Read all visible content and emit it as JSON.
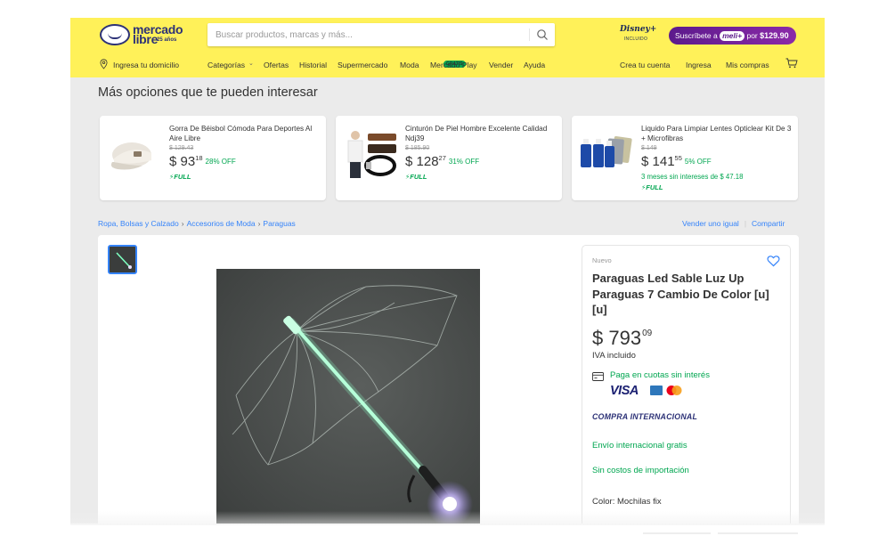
{
  "header": {
    "logo_line1": "mercado",
    "logo_line2": "libre",
    "logo_anos": "25 años",
    "search_placeholder": "Buscar productos, marcas y más...",
    "disney_label": "Disney+",
    "disney_sub": "INCLUIDO",
    "meli_promo": {
      "prefix": "Suscríbete a",
      "brand": "meli+",
      "mid": "por",
      "price": "$129.90"
    },
    "accent": "#fff159"
  },
  "nav": {
    "location": "Ingresa tu domicilio",
    "items": [
      "Categorías",
      "Ofertas",
      "Historial",
      "Supermercado",
      "Moda",
      "Mercado Play",
      "Vender",
      "Ayuda"
    ],
    "gratis_badge": "GRATIS",
    "right": [
      "Crea tu cuenta",
      "Ingresa",
      "Mis compras"
    ]
  },
  "more_options": {
    "title": "Más opciones que te pueden interesar",
    "cards": [
      {
        "title": "Gorra De Béisbol Cómoda Para Deportes Al Aire Libre",
        "old_price": "$ 129.43",
        "price": "$ 93",
        "cents": "18",
        "off": "28% OFF",
        "badge": "FULL",
        "icon": "cap-image"
      },
      {
        "title": "Cinturón De Piel Hombre Excelente Calidad Ndj39",
        "old_price": "$ 185.90",
        "price": "$ 128",
        "cents": "27",
        "off": "31% OFF",
        "badge": "FULL",
        "icon": "belts-image"
      },
      {
        "title": "Liquido Para Limpiar Lentes Opticlear Kit De 3 + Microfibras",
        "old_price": "$ 149",
        "price": "$ 141",
        "cents": "55",
        "off": "5% OFF",
        "installments": "3 meses sin intereses de $ 47.18",
        "badge": "FULL",
        "icon": "spray-bottles-image"
      }
    ]
  },
  "breadcrumb": [
    "Ropa, Bolsas y Calzado",
    "Accesorios de Moda",
    "Paraguas"
  ],
  "actions": [
    "Vender uno igual",
    "Compartir"
  ],
  "product": {
    "condition": "Nuevo",
    "title": "Paraguas Led Sable Luz Up Paraguas 7 Cambio De Color [u] [u]",
    "price": "$ 793",
    "cents": "09",
    "iva": "IVA incluido",
    "installments_link": "Paga en cuotas sin interés",
    "visa": "VISA",
    "international": "COMPRA INTERNACIONAL",
    "shipping": "Envío internacional gratis",
    "import_costs": "Sin costos de importación",
    "color_label": "Color:",
    "color_value": "Mochilas fix",
    "green": "#00a650",
    "link_blue": "#3483fa"
  }
}
